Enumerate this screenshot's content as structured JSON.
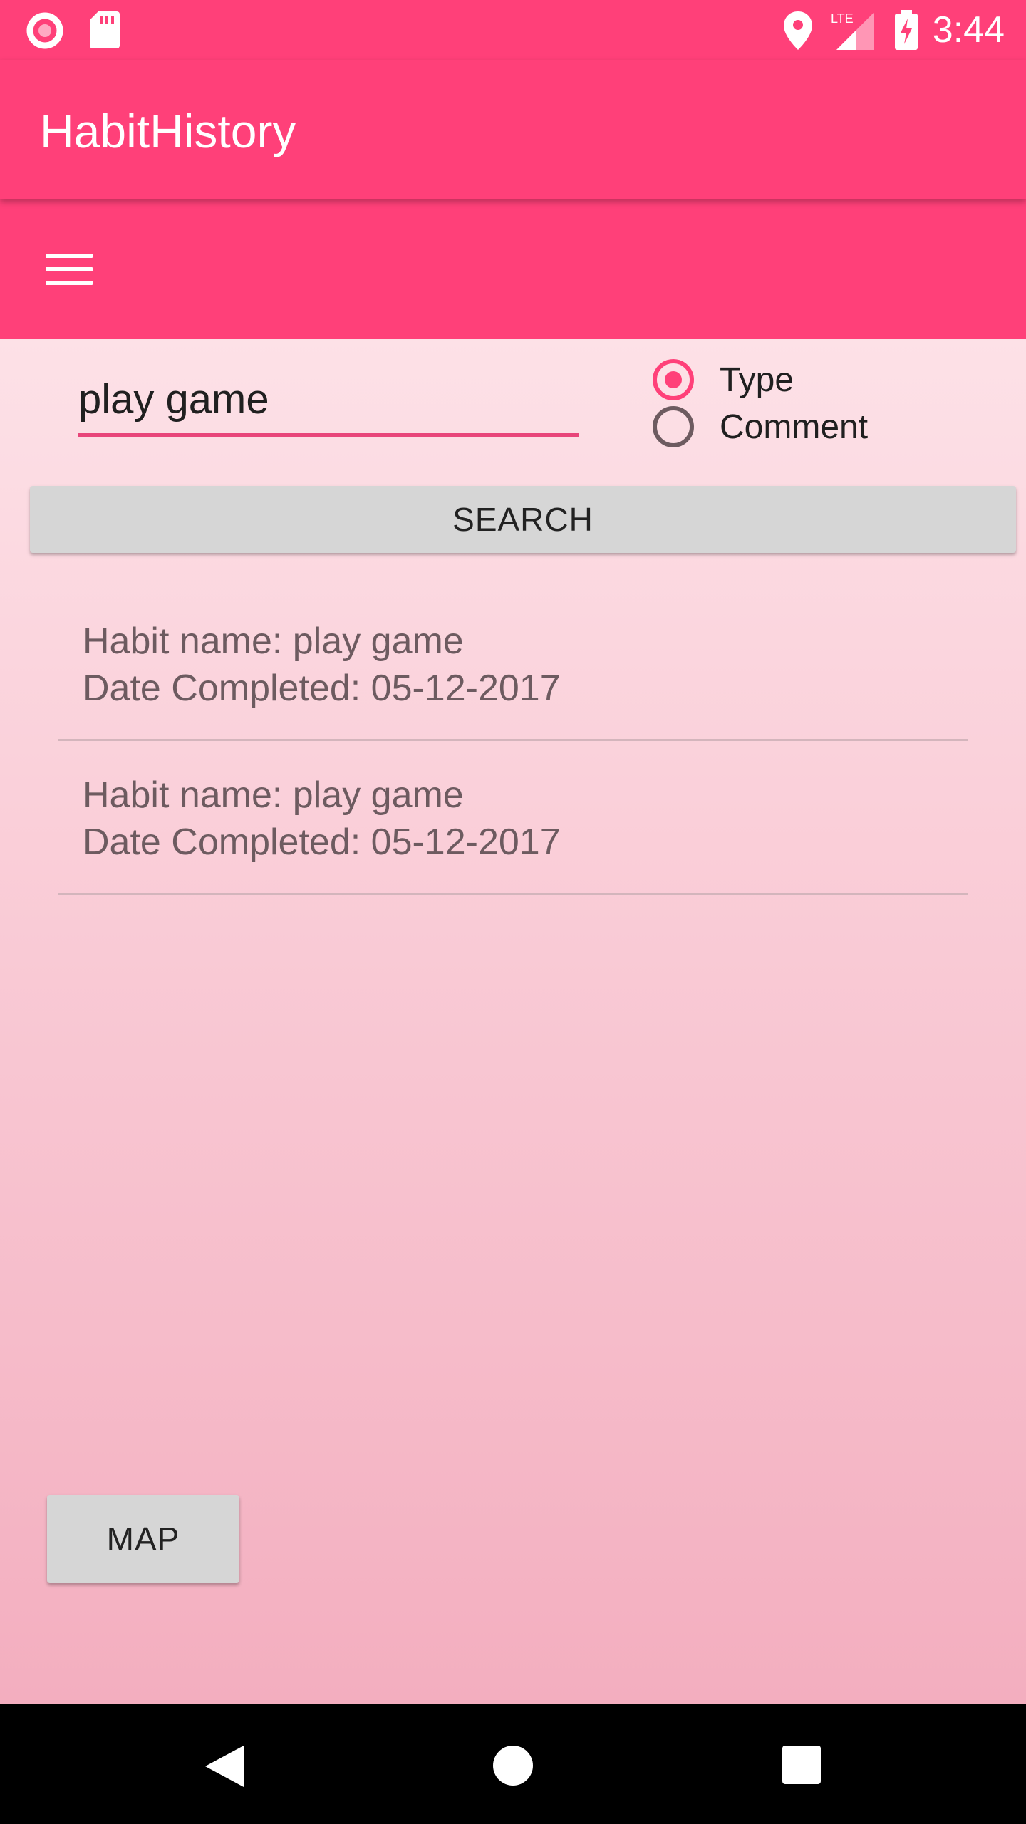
{
  "status_bar": {
    "time": "3:44",
    "network_type": "LTE",
    "icons": [
      "record-icon",
      "sd-card-icon",
      "location-icon",
      "lte-signal-icon",
      "battery-charging-icon"
    ]
  },
  "app_bar": {
    "title": "HabitHistory"
  },
  "toolbar": {
    "menu_icon": "hamburger-menu-icon"
  },
  "search": {
    "value": "play game",
    "radio_options": [
      {
        "label": "Type",
        "checked": true
      },
      {
        "label": "Comment",
        "checked": false
      }
    ],
    "button_label": "SEARCH"
  },
  "results": [
    {
      "habit_name": "Habit name: play game",
      "date_completed": "Date Completed: 05-12-2017"
    },
    {
      "habit_name": "Habit name: play game",
      "date_completed": "Date Completed: 05-12-2017"
    }
  ],
  "map_button_label": "MAP",
  "nav_bar": {
    "icons": [
      "back-icon",
      "home-icon",
      "recents-icon"
    ]
  },
  "colors": {
    "primary": "#ff4079",
    "accent_underline": "#e8457a",
    "background_top": "#fde1e7",
    "background_bottom": "#f3aebf",
    "result_text": "#6d5b60",
    "button_bg": "#d6d6d6",
    "nav_bar": "#000000"
  }
}
